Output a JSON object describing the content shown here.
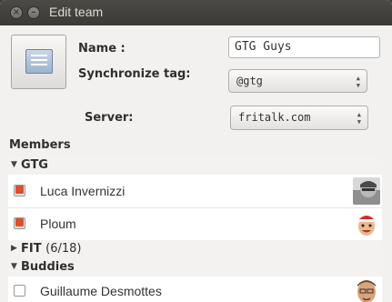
{
  "window": {
    "title": "Edit team"
  },
  "form": {
    "name_label": "Name :",
    "name_value": "GTG Guys",
    "sync_label": "Synchronize tag:",
    "sync_value": "@gtg",
    "server_label": "Server:",
    "server_value": "fritalk.com"
  },
  "members": {
    "label": "Members",
    "groups": [
      {
        "name": "GTG",
        "expanded": true,
        "contacts": [
          {
            "name": "Luca Invernizzi",
            "checked": true
          },
          {
            "name": "Ploum",
            "checked": true
          }
        ]
      },
      {
        "name": "FIT",
        "count": "(6/18)",
        "expanded": false
      },
      {
        "name": "Buddies",
        "expanded": true,
        "contacts": [
          {
            "name": "Guillaume Desmottes",
            "checked": false
          }
        ]
      }
    ]
  },
  "colors": {
    "titlebar": "#3c3b37",
    "check": "#d9522f",
    "window_bg": "#f2f1f0"
  }
}
